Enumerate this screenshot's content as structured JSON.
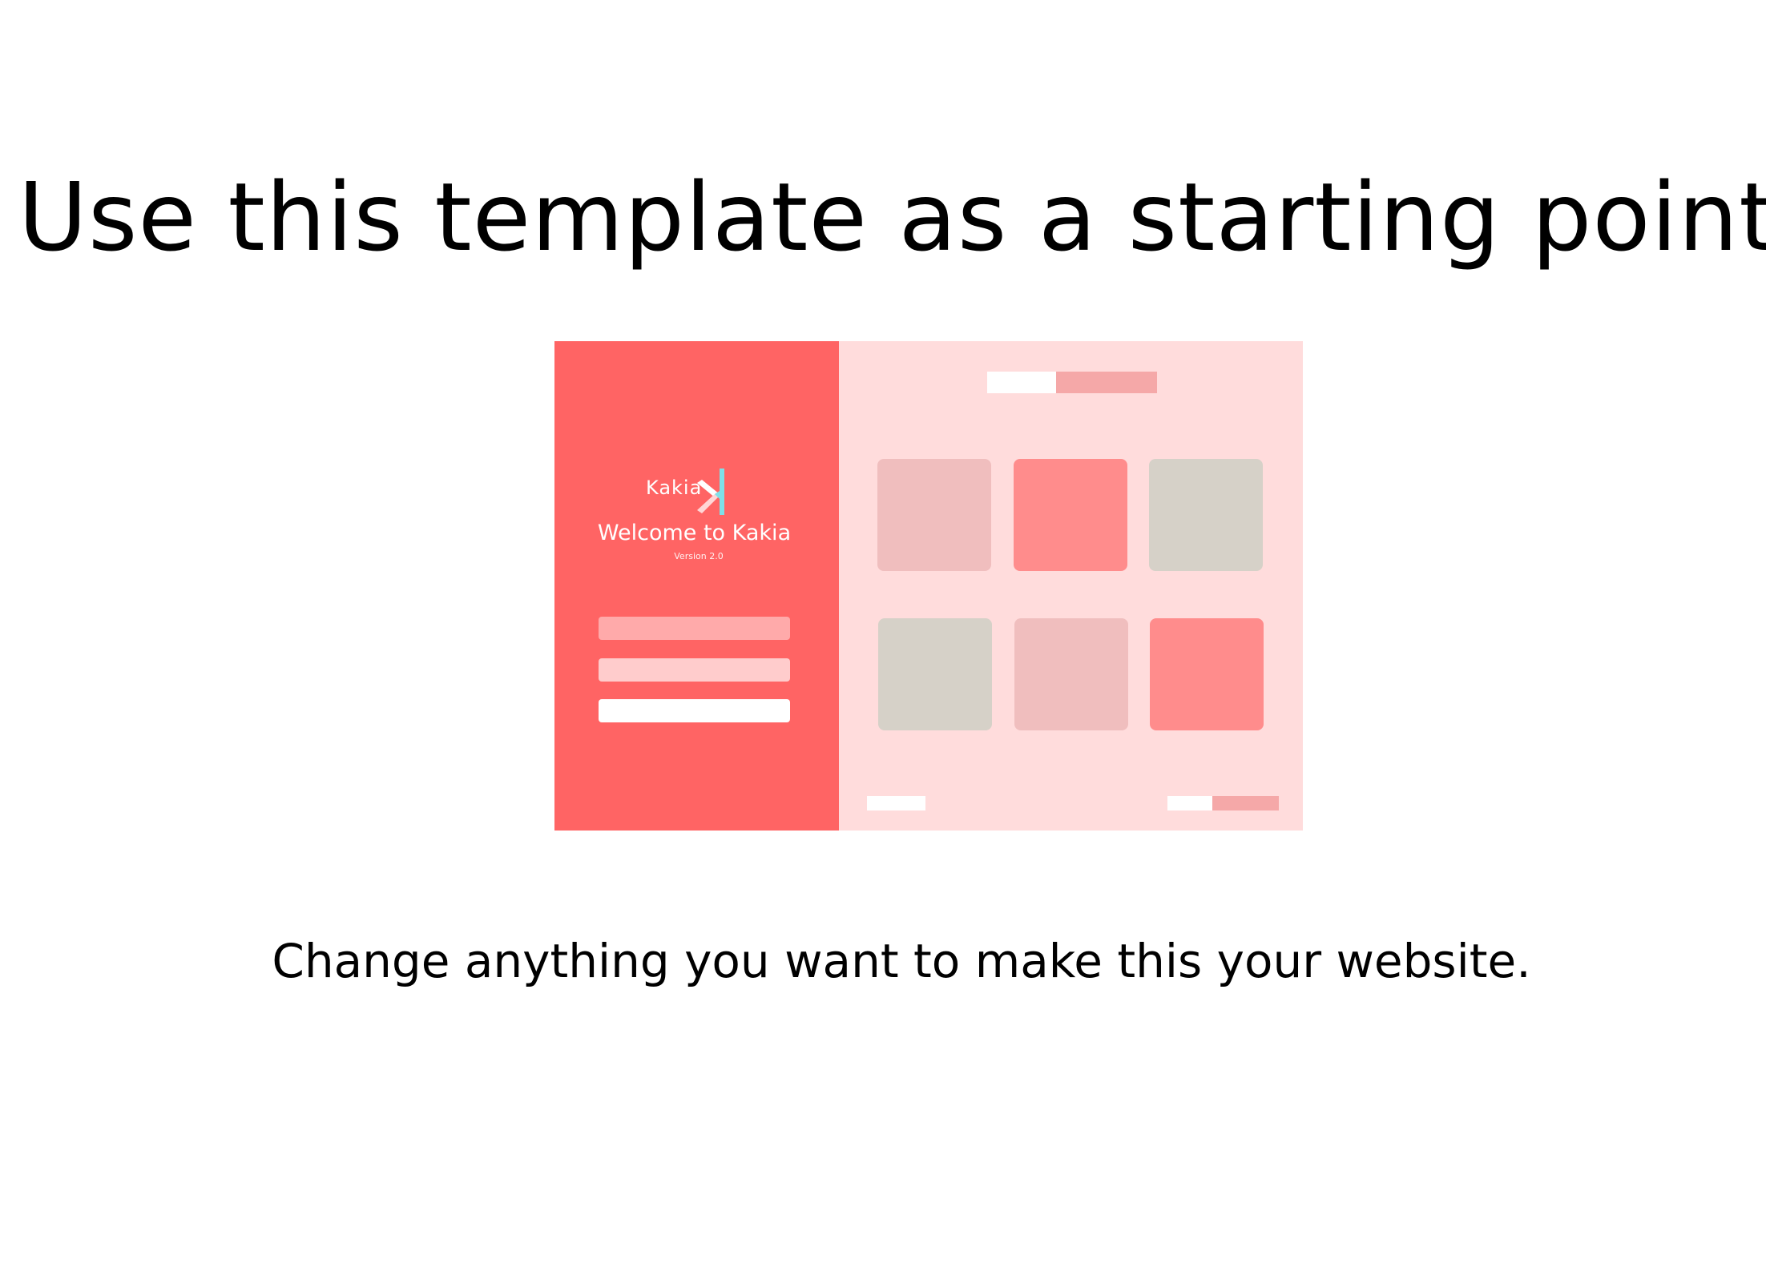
{
  "headline": "Use this template as a starting point",
  "subline": "Change anything you want to make this your website.",
  "mockup": {
    "brand": "Kakia",
    "welcome": "Welcome to Kakia",
    "version": "Version 2.0",
    "colors": {
      "sidebar": "#ff6464",
      "content": "#ffdcdc",
      "accent_k_light": "#7fe0e8",
      "accent_k_white": "#ffffff"
    },
    "fields": [
      {
        "color": "#ffaaaa"
      },
      {
        "color": "#ffcccc"
      },
      {
        "color": "#ffffff"
      }
    ],
    "tiles": [
      {
        "color": "#f0bebe"
      },
      {
        "color": "#ff8c8c"
      },
      {
        "color": "#d6d1c8"
      },
      {
        "color": "#d6d1c8"
      },
      {
        "color": "#f0bebe"
      },
      {
        "color": "#ff8c8c"
      }
    ]
  }
}
